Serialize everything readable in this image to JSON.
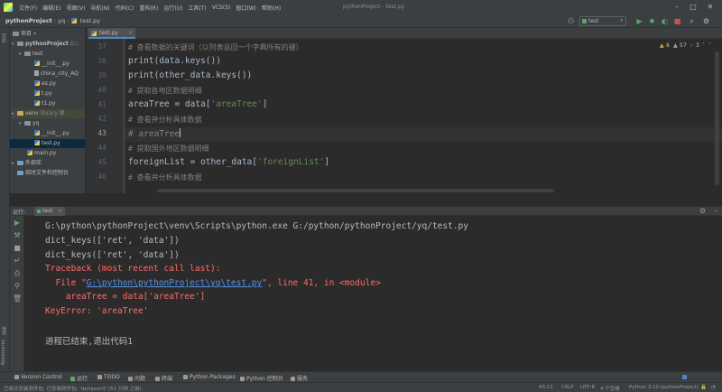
{
  "window": {
    "title": "pythonProject - test.py",
    "menu": [
      "文件(F)",
      "编辑(E)",
      "视图(V)",
      "导航(N)",
      "代码(C)",
      "重构(R)",
      "运行(U)",
      "工具(T)",
      "VCS(S)",
      "窗口(W)",
      "帮助(H)"
    ]
  },
  "breadcrumb": [
    "pythonProject",
    "yq",
    "test.py"
  ],
  "toolbar": {
    "run_config": "test"
  },
  "project_tree": [
    {
      "label": "项目",
      "type": "header"
    },
    {
      "label": "pythonProject",
      "suffix": "G:\\",
      "type": "folder",
      "arrow": "▾"
    },
    {
      "label": "test",
      "type": "folder",
      "arrow": "▾"
    },
    {
      "label": "__init__.py",
      "type": "py"
    },
    {
      "label": "china_city_AQ",
      "type": "file"
    },
    {
      "label": "es.py",
      "type": "py"
    },
    {
      "label": "t.py",
      "type": "py"
    },
    {
      "label": "t1.py",
      "type": "py"
    },
    {
      "label": "venv",
      "suffix": "library 根",
      "type": "folder",
      "arrow": "▸"
    },
    {
      "label": "yq",
      "type": "folder",
      "arrow": "▾"
    },
    {
      "label": "__init__.py",
      "type": "py"
    },
    {
      "label": "test.py",
      "type": "py",
      "selected": true
    },
    {
      "label": "main.py",
      "type": "py"
    },
    {
      "label": "外部库",
      "type": "lib",
      "arrow": "▸"
    },
    {
      "label": "临时文件和控制台",
      "type": "scratch"
    }
  ],
  "editor": {
    "tab_label": "test.py",
    "inspections": {
      "warnings": "8",
      "weak": "57",
      "typos": "3"
    },
    "lines": [
      {
        "n": "37",
        "tokens": [
          {
            "t": "# 查看数据的关键词（以列表返回一个字典所有的键）",
            "c": "comment"
          }
        ]
      },
      {
        "n": "38",
        "tokens": [
          {
            "t": "print(data.keys())",
            "c": "plain"
          }
        ]
      },
      {
        "n": "39",
        "tokens": [
          {
            "t": "print(other_data.keys())",
            "c": "plain"
          }
        ]
      },
      {
        "n": "40",
        "tokens": [
          {
            "t": "# 提取各地区数据明细",
            "c": "comment"
          }
        ]
      },
      {
        "n": "41",
        "tokens": [
          {
            "t": "areaTree = data[",
            "c": "plain"
          },
          {
            "t": "'areaTree'",
            "c": "str"
          },
          {
            "t": "]",
            "c": "plain"
          }
        ]
      },
      {
        "n": "42",
        "tokens": [
          {
            "t": "# 查看并分析具体数据",
            "c": "comment"
          }
        ]
      },
      {
        "n": "43",
        "tokens": [
          {
            "t": "# areaTree",
            "c": "comment-big"
          }
        ],
        "current": true
      },
      {
        "n": "44",
        "tokens": [
          {
            "t": "# 提取国外地区数据明细",
            "c": "comment"
          }
        ]
      },
      {
        "n": "45",
        "tokens": [
          {
            "t": "foreignList = other_data[",
            "c": "plain"
          },
          {
            "t": "'foreignList'",
            "c": "str"
          },
          {
            "t": "]",
            "c": "plain"
          }
        ]
      },
      {
        "n": "46",
        "tokens": [
          {
            "t": "# 查看并分析具体数据",
            "c": "comment"
          }
        ]
      }
    ]
  },
  "run": {
    "label": "运行:",
    "tab": "test",
    "output": [
      {
        "parts": [
          {
            "t": "G:\\python\\pythonProject\\venv\\Scripts\\python.exe G:/python/pythonProject/yq/test.py",
            "c": "plain"
          }
        ]
      },
      {
        "parts": [
          {
            "t": "dict_keys(['ret', 'data'])",
            "c": "plain"
          }
        ]
      },
      {
        "parts": [
          {
            "t": "dict_keys(['ret', 'data'])",
            "c": "plain"
          }
        ]
      },
      {
        "parts": [
          {
            "t": "Traceback (most recent call last):",
            "c": "err"
          }
        ]
      },
      {
        "parts": [
          {
            "t": "  File \"",
            "c": "err"
          },
          {
            "t": "G:\\python\\pythonProject\\yq\\test.py",
            "c": "link"
          },
          {
            "t": "\", line 41, in <module>",
            "c": "err"
          }
        ]
      },
      {
        "parts": [
          {
            "t": "    areaTree = data['areaTree']",
            "c": "err"
          }
        ]
      },
      {
        "parts": [
          {
            "t": "KeyError: 'areaTree'",
            "c": "err"
          }
        ]
      },
      {
        "parts": [
          {
            "t": "",
            "c": "plain"
          }
        ]
      },
      {
        "parts": [
          {
            "t": "进程已结束,退出代码1",
            "c": "plain"
          }
        ]
      }
    ]
  },
  "bottom_tabs": [
    "Version Control",
    "运行",
    "TODO",
    "问题",
    "终端",
    "Python Packages",
    "Python 控制台",
    "服务"
  ],
  "status": {
    "message": "已成功安装软件包: 已安装软件包: 'demjson3' (51 分钟 之前)",
    "position": "43:11",
    "line_sep": "CRLF",
    "encoding": "UTF-8",
    "indent": "4 个空格",
    "interpreter": "Python 3.10 (pythonProject)"
  },
  "left_strip_tabs": [
    "项目",
    "结构",
    "Bookmarks"
  ]
}
